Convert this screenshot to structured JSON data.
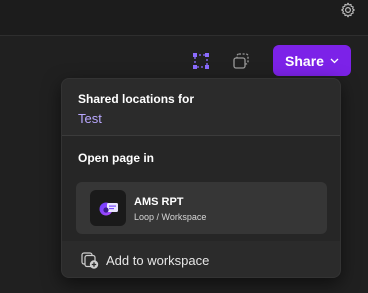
{
  "topbar": {
    "settings_icon": "gear-icon"
  },
  "toolbar": {
    "select_icon": "selection-handles-icon",
    "copy_icon": "copy-frame-icon",
    "share_label": "Share",
    "share_chevron_icon": "chevron-down-icon",
    "accent_color": "#7c22e8",
    "select_icon_color": "#8b6cff"
  },
  "popover": {
    "title": "Shared locations for",
    "location": "Test",
    "open_label": "Open page in",
    "page": {
      "icon": "loop-app-icon",
      "title": "AMS RPT",
      "subtitle": "Loop / Workspace"
    },
    "add_label": "Add to workspace",
    "add_icon": "add-to-workspace-icon"
  }
}
